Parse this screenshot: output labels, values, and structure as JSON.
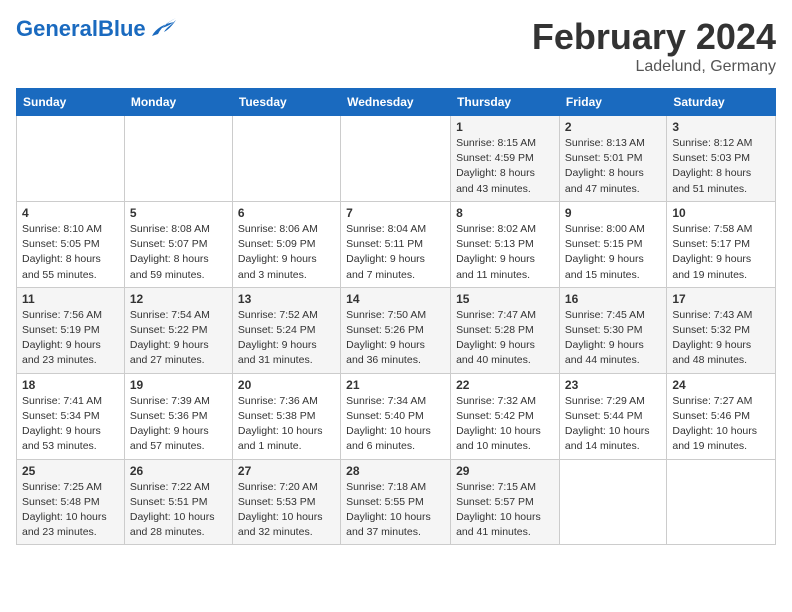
{
  "logo": {
    "text_general": "General",
    "text_blue": "Blue"
  },
  "calendar": {
    "title": "February 2024",
    "subtitle": "Ladelund, Germany",
    "headers": [
      "Sunday",
      "Monday",
      "Tuesday",
      "Wednesday",
      "Thursday",
      "Friday",
      "Saturday"
    ],
    "weeks": [
      [
        {
          "day": "",
          "info": ""
        },
        {
          "day": "",
          "info": ""
        },
        {
          "day": "",
          "info": ""
        },
        {
          "day": "",
          "info": ""
        },
        {
          "day": "1",
          "info": "Sunrise: 8:15 AM\nSunset: 4:59 PM\nDaylight: 8 hours\nand 43 minutes."
        },
        {
          "day": "2",
          "info": "Sunrise: 8:13 AM\nSunset: 5:01 PM\nDaylight: 8 hours\nand 47 minutes."
        },
        {
          "day": "3",
          "info": "Sunrise: 8:12 AM\nSunset: 5:03 PM\nDaylight: 8 hours\nand 51 minutes."
        }
      ],
      [
        {
          "day": "4",
          "info": "Sunrise: 8:10 AM\nSunset: 5:05 PM\nDaylight: 8 hours\nand 55 minutes."
        },
        {
          "day": "5",
          "info": "Sunrise: 8:08 AM\nSunset: 5:07 PM\nDaylight: 8 hours\nand 59 minutes."
        },
        {
          "day": "6",
          "info": "Sunrise: 8:06 AM\nSunset: 5:09 PM\nDaylight: 9 hours\nand 3 minutes."
        },
        {
          "day": "7",
          "info": "Sunrise: 8:04 AM\nSunset: 5:11 PM\nDaylight: 9 hours\nand 7 minutes."
        },
        {
          "day": "8",
          "info": "Sunrise: 8:02 AM\nSunset: 5:13 PM\nDaylight: 9 hours\nand 11 minutes."
        },
        {
          "day": "9",
          "info": "Sunrise: 8:00 AM\nSunset: 5:15 PM\nDaylight: 9 hours\nand 15 minutes."
        },
        {
          "day": "10",
          "info": "Sunrise: 7:58 AM\nSunset: 5:17 PM\nDaylight: 9 hours\nand 19 minutes."
        }
      ],
      [
        {
          "day": "11",
          "info": "Sunrise: 7:56 AM\nSunset: 5:19 PM\nDaylight: 9 hours\nand 23 minutes."
        },
        {
          "day": "12",
          "info": "Sunrise: 7:54 AM\nSunset: 5:22 PM\nDaylight: 9 hours\nand 27 minutes."
        },
        {
          "day": "13",
          "info": "Sunrise: 7:52 AM\nSunset: 5:24 PM\nDaylight: 9 hours\nand 31 minutes."
        },
        {
          "day": "14",
          "info": "Sunrise: 7:50 AM\nSunset: 5:26 PM\nDaylight: 9 hours\nand 36 minutes."
        },
        {
          "day": "15",
          "info": "Sunrise: 7:47 AM\nSunset: 5:28 PM\nDaylight: 9 hours\nand 40 minutes."
        },
        {
          "day": "16",
          "info": "Sunrise: 7:45 AM\nSunset: 5:30 PM\nDaylight: 9 hours\nand 44 minutes."
        },
        {
          "day": "17",
          "info": "Sunrise: 7:43 AM\nSunset: 5:32 PM\nDaylight: 9 hours\nand 48 minutes."
        }
      ],
      [
        {
          "day": "18",
          "info": "Sunrise: 7:41 AM\nSunset: 5:34 PM\nDaylight: 9 hours\nand 53 minutes."
        },
        {
          "day": "19",
          "info": "Sunrise: 7:39 AM\nSunset: 5:36 PM\nDaylight: 9 hours\nand 57 minutes."
        },
        {
          "day": "20",
          "info": "Sunrise: 7:36 AM\nSunset: 5:38 PM\nDaylight: 10 hours\nand 1 minute."
        },
        {
          "day": "21",
          "info": "Sunrise: 7:34 AM\nSunset: 5:40 PM\nDaylight: 10 hours\nand 6 minutes."
        },
        {
          "day": "22",
          "info": "Sunrise: 7:32 AM\nSunset: 5:42 PM\nDaylight: 10 hours\nand 10 minutes."
        },
        {
          "day": "23",
          "info": "Sunrise: 7:29 AM\nSunset: 5:44 PM\nDaylight: 10 hours\nand 14 minutes."
        },
        {
          "day": "24",
          "info": "Sunrise: 7:27 AM\nSunset: 5:46 PM\nDaylight: 10 hours\nand 19 minutes."
        }
      ],
      [
        {
          "day": "25",
          "info": "Sunrise: 7:25 AM\nSunset: 5:48 PM\nDaylight: 10 hours\nand 23 minutes."
        },
        {
          "day": "26",
          "info": "Sunrise: 7:22 AM\nSunset: 5:51 PM\nDaylight: 10 hours\nand 28 minutes."
        },
        {
          "day": "27",
          "info": "Sunrise: 7:20 AM\nSunset: 5:53 PM\nDaylight: 10 hours\nand 32 minutes."
        },
        {
          "day": "28",
          "info": "Sunrise: 7:18 AM\nSunset: 5:55 PM\nDaylight: 10 hours\nand 37 minutes."
        },
        {
          "day": "29",
          "info": "Sunrise: 7:15 AM\nSunset: 5:57 PM\nDaylight: 10 hours\nand 41 minutes."
        },
        {
          "day": "",
          "info": ""
        },
        {
          "day": "",
          "info": ""
        }
      ]
    ]
  }
}
